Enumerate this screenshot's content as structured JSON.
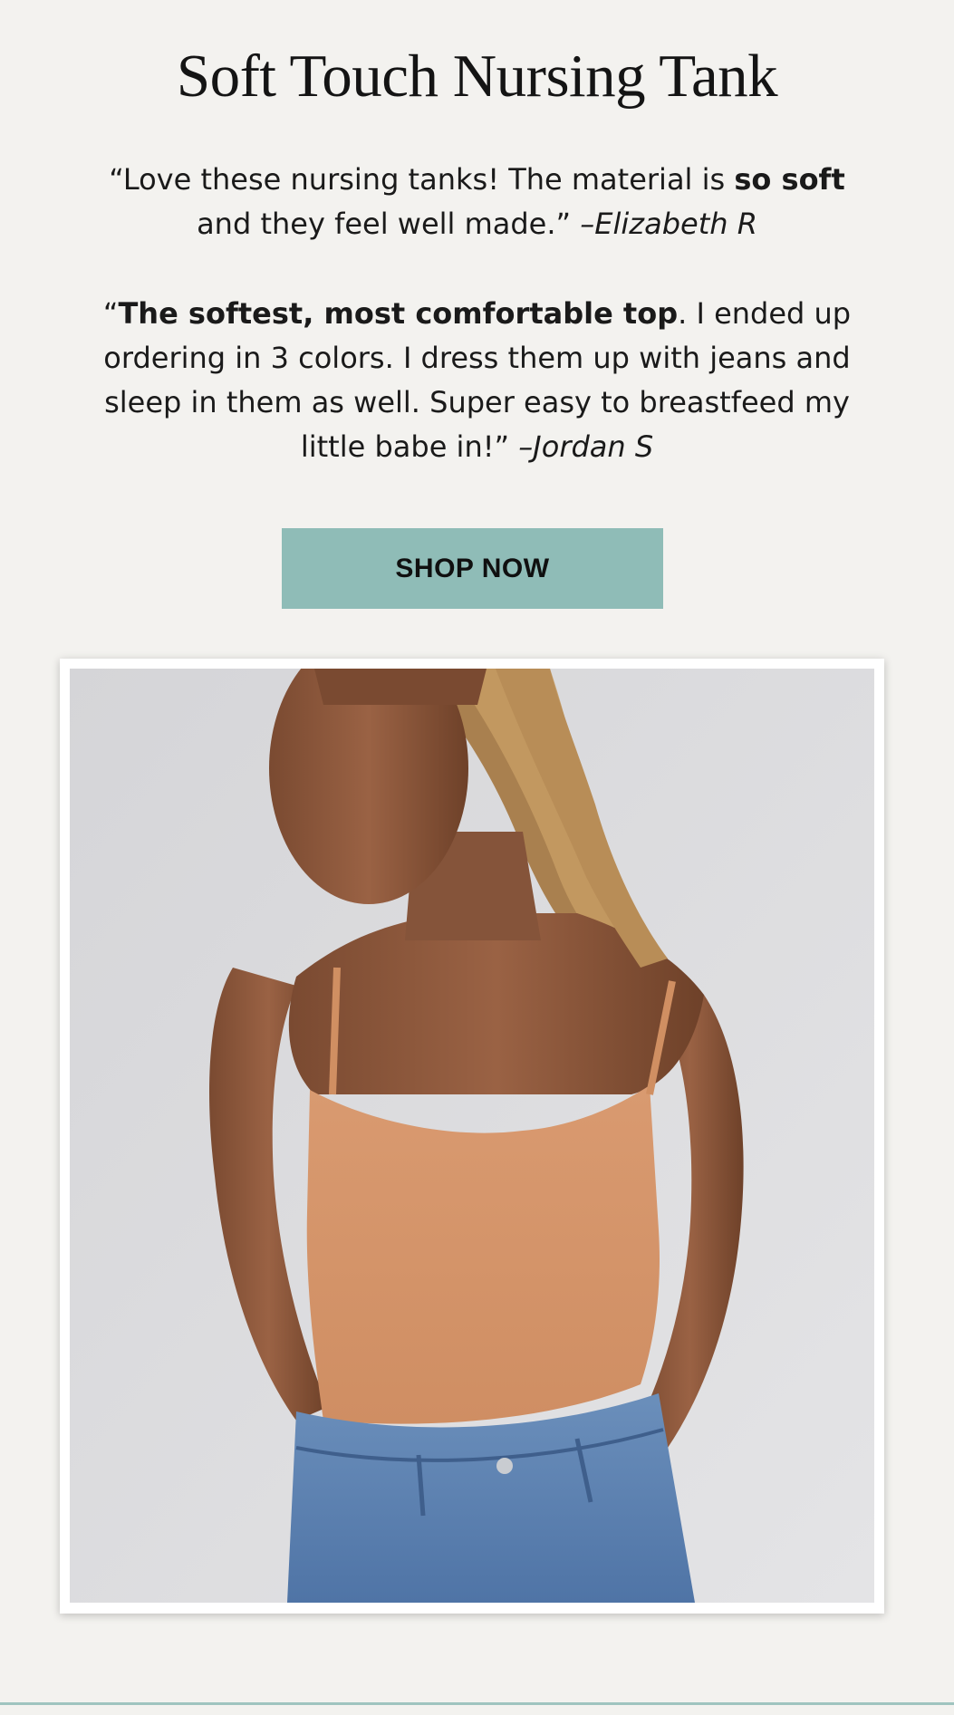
{
  "page": {
    "title": "Soft Touch Nursing Tank"
  },
  "reviews": [
    {
      "open_quote": "“",
      "text_before": "Love these nursing tanks! The material is ",
      "bold": "so soft",
      "text_after": " and they feel well made.” ",
      "author": "–Elizabeth R"
    },
    {
      "open_quote": "“",
      "text_before": "",
      "bold": "The softest, most comfortable top",
      "text_after": ". I ended up ordering in 3 colors. I dress them up with jeans and sleep in them as well. Super easy to breastfeed my little babe in!” ",
      "author": "–Jordan S"
    }
  ],
  "cta": {
    "label": "SHOP NOW"
  },
  "colors": {
    "background": "#f3f2ef",
    "button": "#8fbcb7",
    "tank_top": "#d4956b",
    "denim": "#5b7fae"
  }
}
